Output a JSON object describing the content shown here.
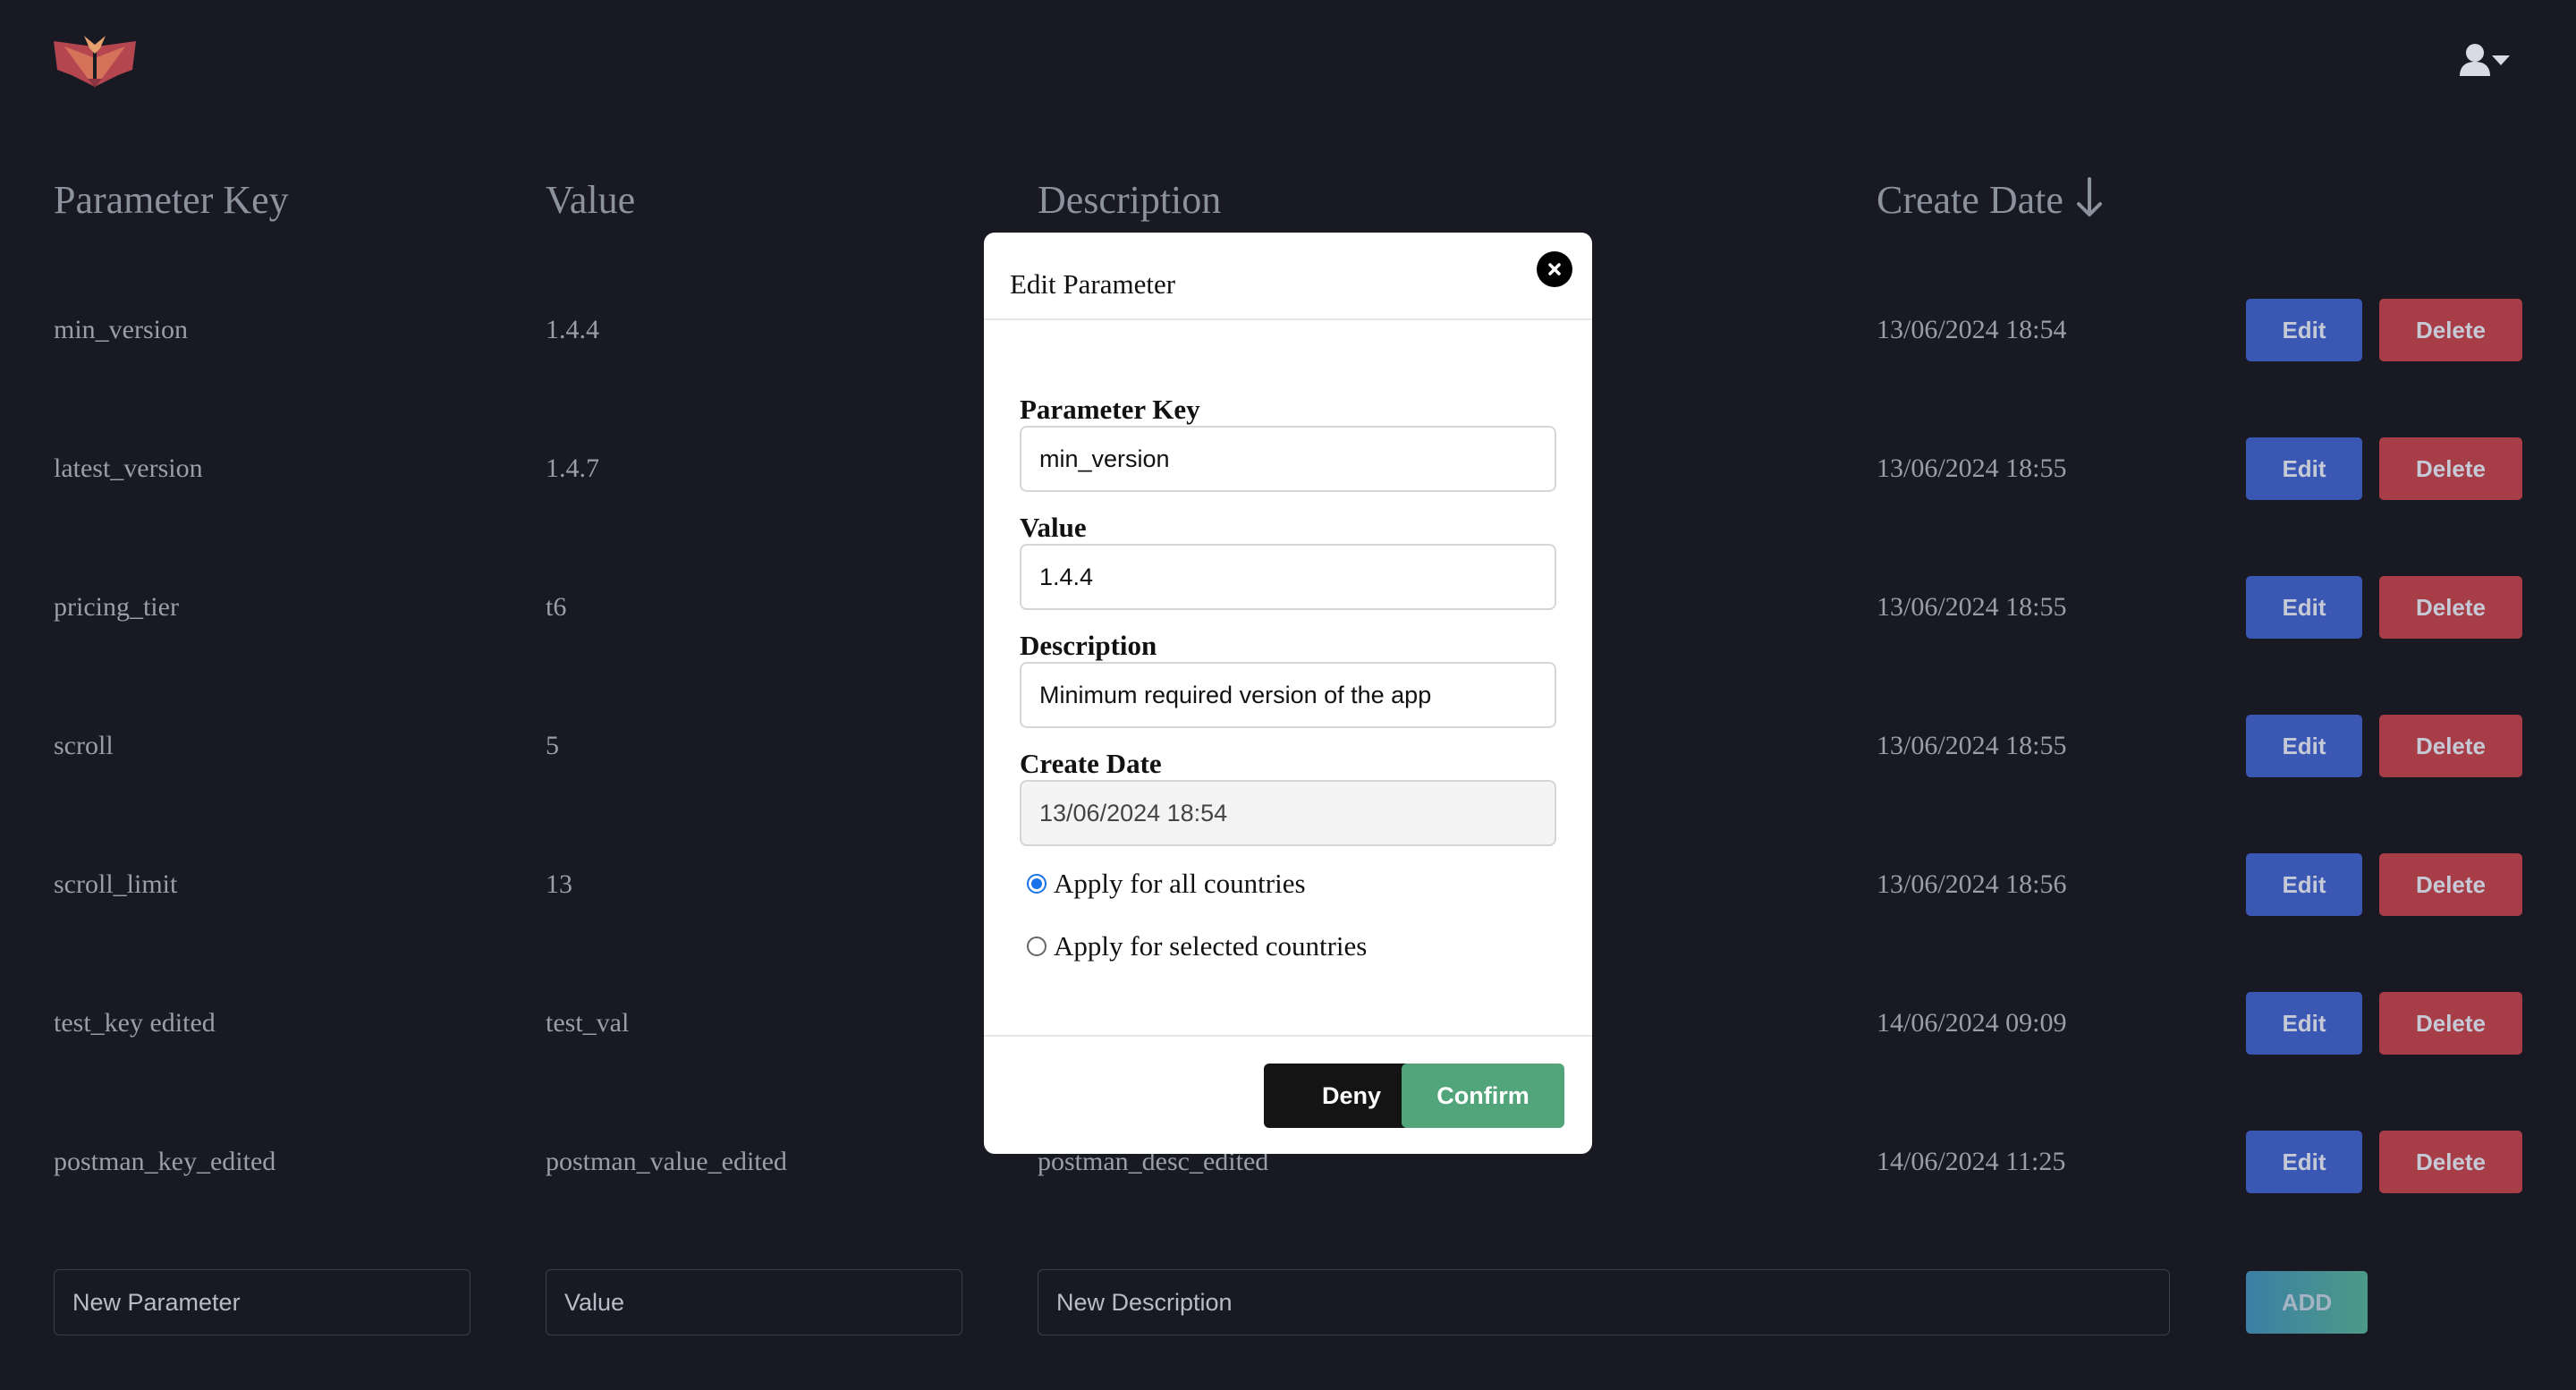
{
  "header": {
    "logo_icon": "book-logo-icon",
    "user_menu_icon": "user-dropdown-icon"
  },
  "table": {
    "columns": [
      "Parameter Key",
      "Value",
      "Description",
      "Create Date"
    ],
    "sort_icon": "arrow-down-icon",
    "rows": [
      {
        "key": "min_version",
        "value": "1.4.4",
        "description": "",
        "date": "13/06/2024 18:54"
      },
      {
        "key": "latest_version",
        "value": "1.4.7",
        "description": "",
        "date": "13/06/2024 18:55"
      },
      {
        "key": "pricing_tier",
        "value": "t6",
        "description": "",
        "date": "13/06/2024 18:55"
      },
      {
        "key": "scroll",
        "value": "5",
        "description": "",
        "date": "13/06/2024 18:55"
      },
      {
        "key": "scroll_limit",
        "value": "13",
        "description": "",
        "date": "13/06/2024 18:56"
      },
      {
        "key": "test_key edited",
        "value": "test_val",
        "description": "",
        "date": "14/06/2024 09:09"
      },
      {
        "key": "postman_key_edited",
        "value": "postman_value_edited",
        "description": "postman_desc_edited",
        "date": "14/06/2024 11:25"
      }
    ],
    "edit_label": "Edit",
    "delete_label": "Delete"
  },
  "new_row": {
    "key_placeholder": "New Parameter",
    "value_placeholder": "Value",
    "description_placeholder": "New Description",
    "add_label": "ADD"
  },
  "modal": {
    "title": "Edit Parameter",
    "close_icon": "close-icon",
    "fields": {
      "key_label": "Parameter Key",
      "key_value": "min_version",
      "value_label": "Value",
      "value_value": "1.4.4",
      "description_label": "Description",
      "description_value": "Minimum required version of the app",
      "date_label": "Create Date",
      "date_value": "13/06/2024 18:54"
    },
    "radio_all": "Apply for all countries",
    "radio_selected": "Apply for selected countries",
    "deny_label": "Deny",
    "confirm_label": "Confirm"
  },
  "colors": {
    "background": "#181923",
    "edit": "#3a57b4",
    "delete": "#a63d47",
    "confirm": "#52a57a",
    "deny": "#141414"
  }
}
